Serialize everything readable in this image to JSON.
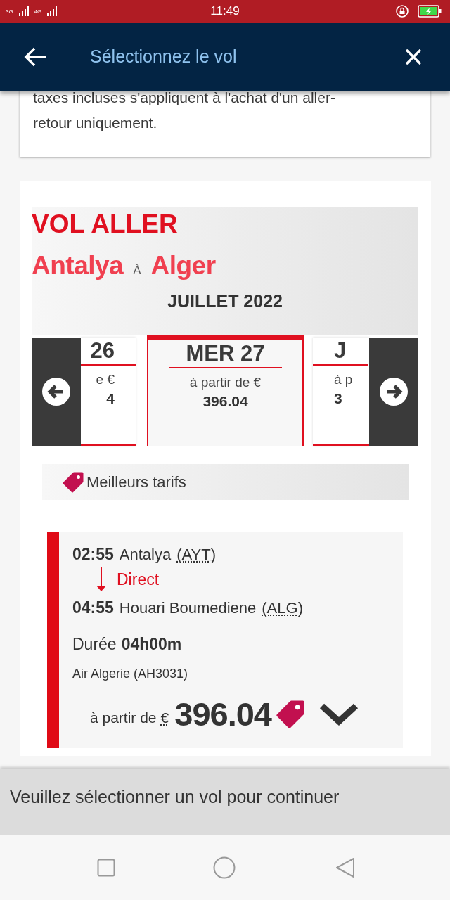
{
  "status_bar": {
    "signal_1": "3G",
    "signal_2": "4G",
    "time": "11:49"
  },
  "header": {
    "title": "Sélectionnez le vol"
  },
  "notice": {
    "lines": [
      "taxes incluses s'appliquent à l'achat d'un aller-",
      "retour uniquement."
    ]
  },
  "outbound": {
    "heading": "VOL ALLER",
    "origin": "Antalya",
    "connector": "À",
    "destination": "Alger",
    "month": "JUILLET 2022",
    "dates": [
      {
        "day": "26",
        "label": "e €",
        "price": "4",
        "selected": false,
        "kind": "previous"
      },
      {
        "day": "MER 27",
        "label": "à partir de €",
        "price": "396.04",
        "selected": true,
        "kind": "current"
      },
      {
        "day": "J",
        "label": "à p",
        "price": "3",
        "selected": false,
        "kind": "next"
      }
    ],
    "best_fares": "Meilleurs tarifs"
  },
  "flights": [
    {
      "departure_time": "02:55",
      "departure_airport": "Antalya",
      "departure_code": "(AYT)",
      "stops": "Direct",
      "arrival_time": "04:55",
      "arrival_airport": "Houari Boumediene",
      "arrival_code": "(ALG)",
      "duration_label": "Durée",
      "duration": "04h00m",
      "carrier": "Air Algerie (AH3031)",
      "price_label": "à partir de",
      "currency": "€",
      "price": "396.04",
      "best_fare": true,
      "expanded": false
    }
  ],
  "footer": {
    "message": "Veuillez sélectionner un vol pour continuer"
  }
}
